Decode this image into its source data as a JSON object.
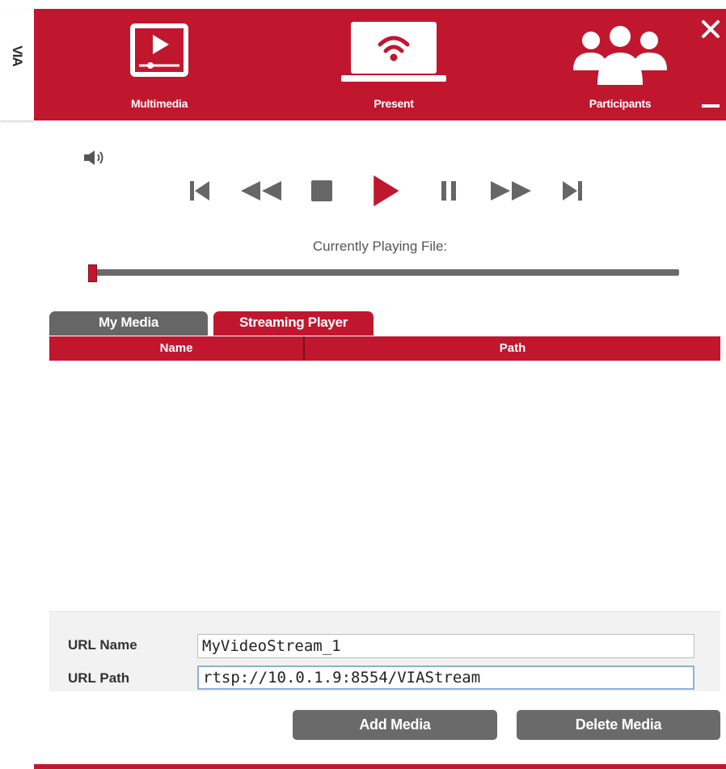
{
  "sidebar": {
    "logo_text": "VIA"
  },
  "header": {
    "nav": [
      {
        "label": "Multimedia",
        "icon": "video-screen-icon"
      },
      {
        "label": "Present",
        "icon": "wireless-laptop-icon"
      },
      {
        "label": "Participants",
        "icon": "people-icon"
      }
    ],
    "close_icon": "close-icon",
    "minimize_icon": "minimize-icon"
  },
  "player": {
    "controls": [
      "skip-previous-icon",
      "rewind-icon",
      "stop-icon",
      "play-icon",
      "pause-icon",
      "fast-forward-icon",
      "skip-next-icon"
    ],
    "volume_icon": "volume-icon",
    "currently_playing_label": "Currently Playing File:",
    "progress": 0
  },
  "tabs": [
    {
      "label": "My Media",
      "active": false
    },
    {
      "label": "Streaming Player",
      "active": true
    }
  ],
  "table": {
    "columns": [
      "Name",
      "Path"
    ],
    "rows": []
  },
  "url_form": {
    "name_label": "URL Name",
    "name_value": "MyVideoStream_1",
    "path_label": "URL Path",
    "path_value": "rtsp://10.0.1.9:8554/VIAStream"
  },
  "buttons": {
    "add_label": "Add Media",
    "delete_label": "Delete Media"
  },
  "colors": {
    "accent": "#c0172f",
    "tab_inactive": "#666666",
    "button": "#6a6a6a"
  }
}
